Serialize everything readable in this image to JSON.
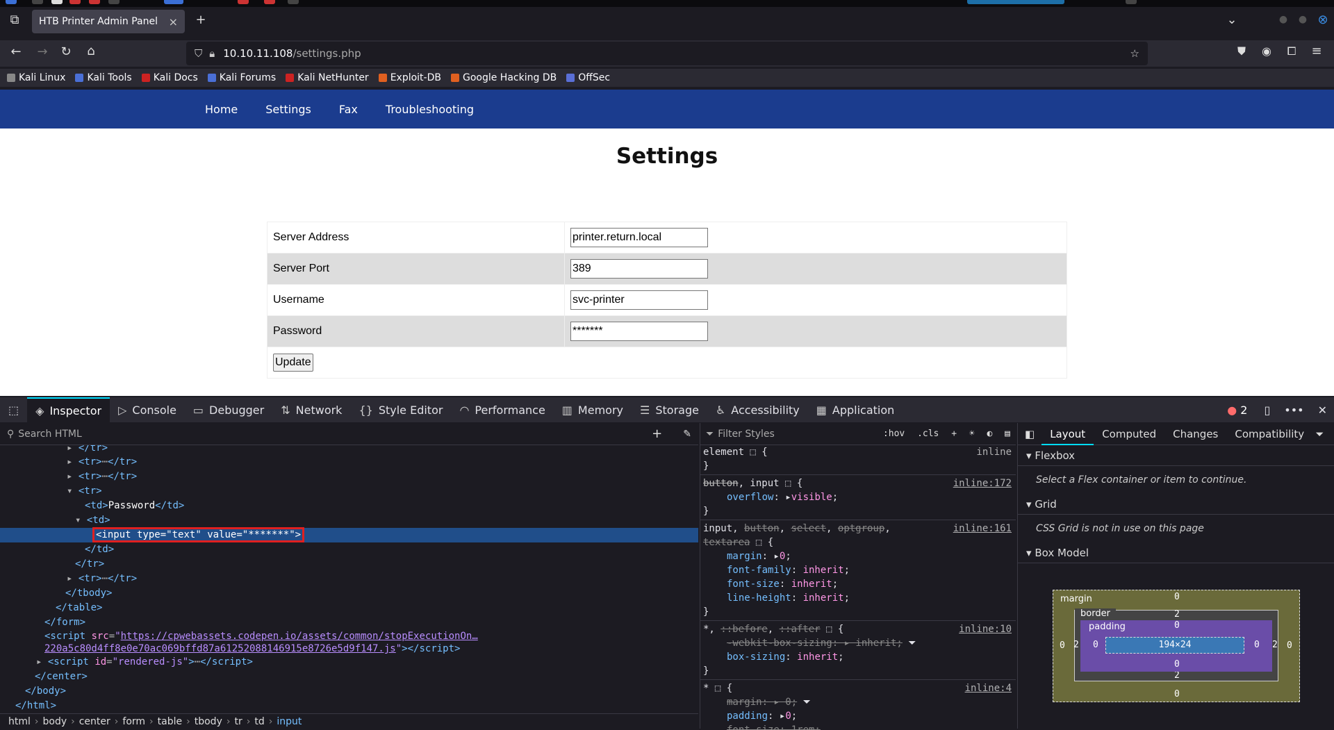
{
  "browser": {
    "tab_title": "HTB Printer Admin Panel",
    "url_host": "10.10.11.108",
    "url_path": "/settings.php",
    "bookmarks": [
      "Kali Linux",
      "Kali Tools",
      "Kali Docs",
      "Kali Forums",
      "Kali NetHunter",
      "Exploit-DB",
      "Google Hacking DB",
      "OffSec"
    ]
  },
  "site": {
    "nav": [
      "Home",
      "Settings",
      "Fax",
      "Troubleshooting"
    ],
    "title": "Settings",
    "rows": [
      {
        "label": "Server Address",
        "value": "printer.return.local"
      },
      {
        "label": "Server Port",
        "value": "389"
      },
      {
        "label": "Username",
        "value": "svc-printer"
      },
      {
        "label": "Password",
        "value": "*******"
      }
    ],
    "update_label": "Update"
  },
  "devtools": {
    "tabs": [
      "Inspector",
      "Console",
      "Debugger",
      "Network",
      "Style Editor",
      "Performance",
      "Memory",
      "Storage",
      "Accessibility",
      "Application"
    ],
    "error_count": "2",
    "search_placeholder": "Search HTML",
    "filter_placeholder": "Filter Styles",
    "hov": ":hov",
    "cls": ".cls",
    "script_src": "https://cpwebassets.codepen.io/assets/common/stopExecutionOn…",
    "script_src2": "220a5c80d4ff8e0e70ac069bffd87a61252088146915e8726e5d9f147.js",
    "breadcrumbs": [
      "html",
      "body",
      "center",
      "form",
      "table",
      "tbody",
      "tr",
      "td",
      "input"
    ],
    "layout_tabs": [
      "Layout",
      "Computed",
      "Changes",
      "Compatibility"
    ],
    "flexbox_title": "Flexbox",
    "flexbox_msg": "Select a Flex container or item to continue.",
    "grid_title": "Grid",
    "grid_msg": "CSS Grid is not in use on this page",
    "boxmodel_title": "Box Model",
    "box": {
      "margin_label": "margin",
      "border_label": "border",
      "padding_label": "padding",
      "content": "194×24",
      "margin": "0",
      "border": "2",
      "padding": "0"
    }
  }
}
